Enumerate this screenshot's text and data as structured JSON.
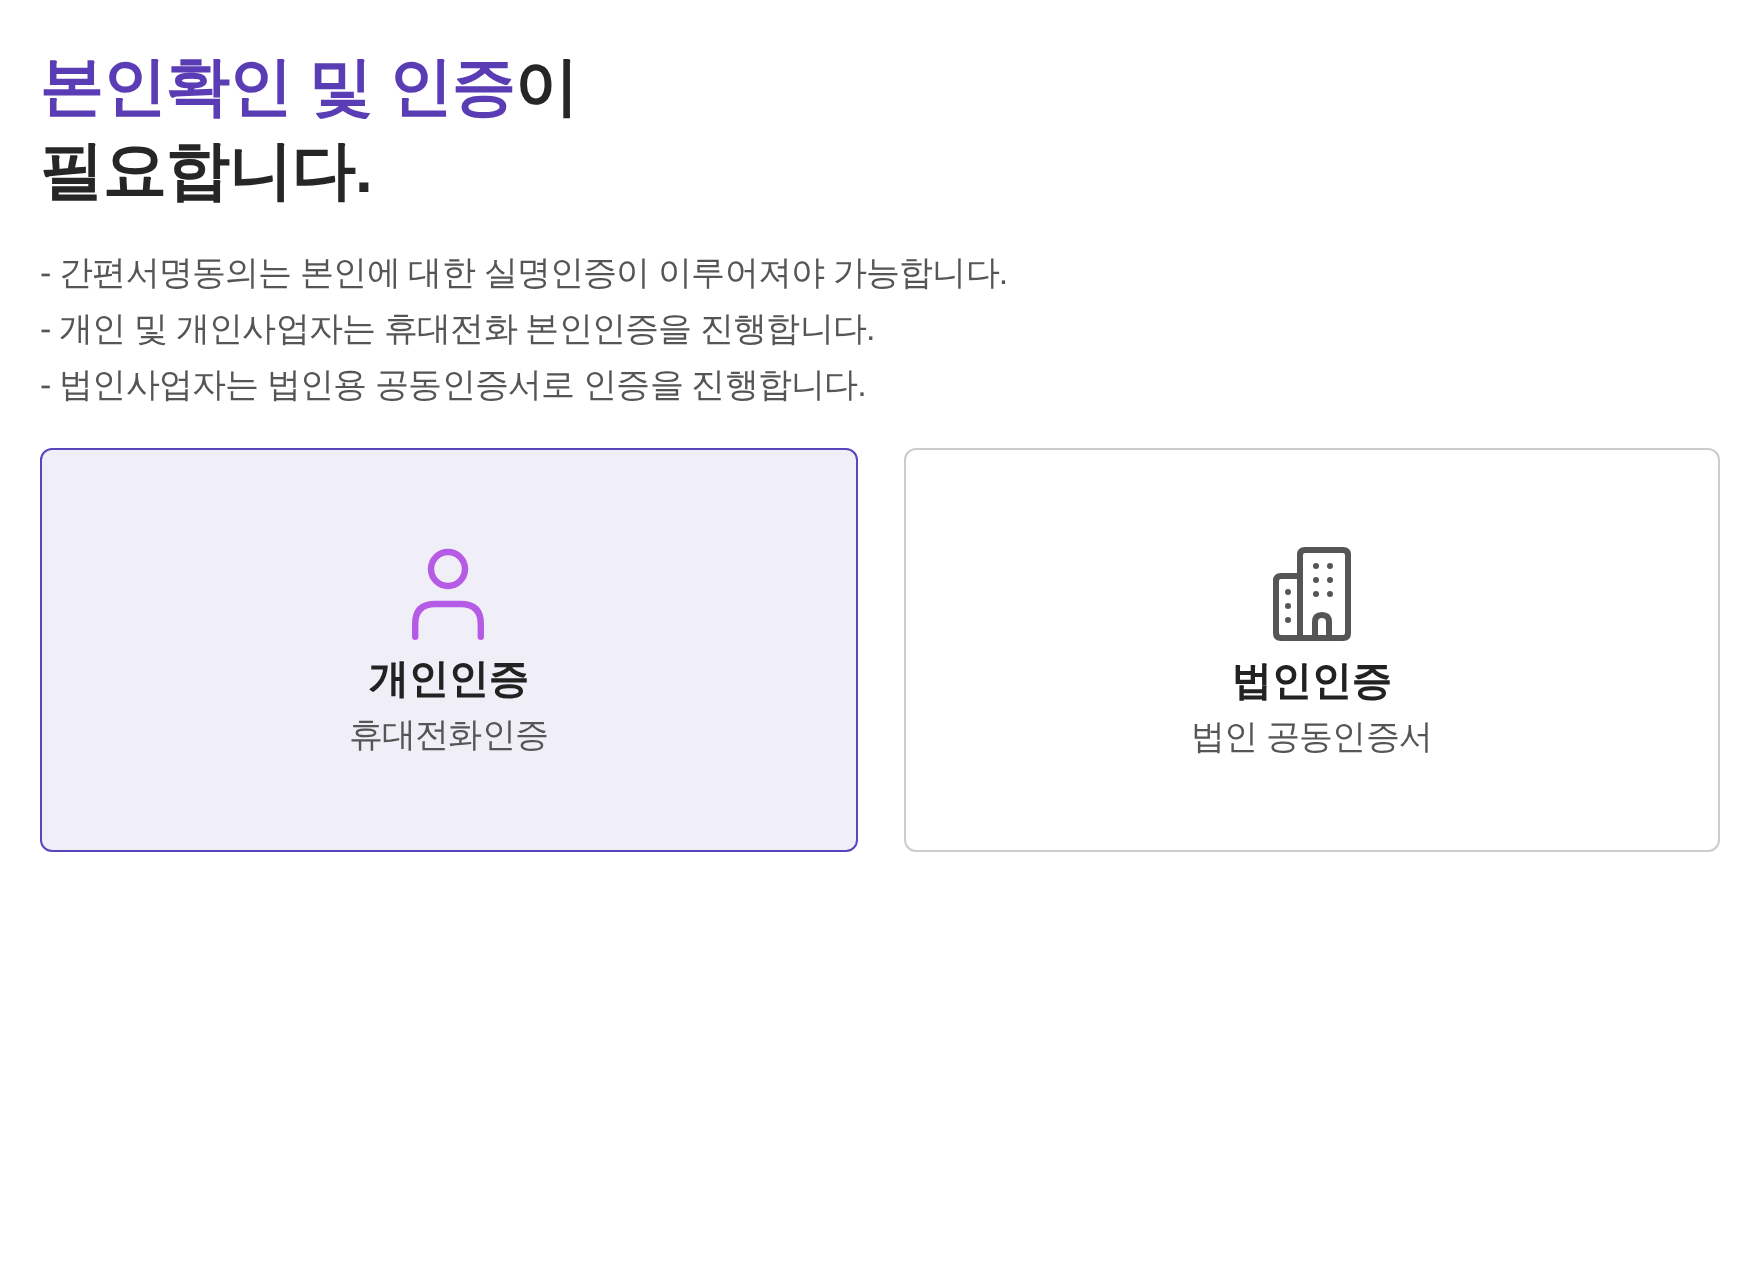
{
  "title": {
    "lines": [
      {
        "accent": "본인확인 및 인증",
        "text": "이"
      },
      {
        "text": "필요합니다."
      }
    ]
  },
  "notices": [
    "- 간편서명동의는 본인에 대한 실명인증이 이루어져야 가능합니다.",
    "- 개인 및 개인사업자는 휴대전화 본인인증을 진행합니다.",
    "- 법인사업자는 법인용 공동인증서로 인증을 진행합니다."
  ],
  "cards": [
    {
      "kind": "person",
      "title": "개인인증",
      "subtitle": "휴대전화인증",
      "selected": true
    },
    {
      "kind": "building",
      "title": "법인인증",
      "subtitle": "법인 공동인증서",
      "selected": false
    }
  ]
}
